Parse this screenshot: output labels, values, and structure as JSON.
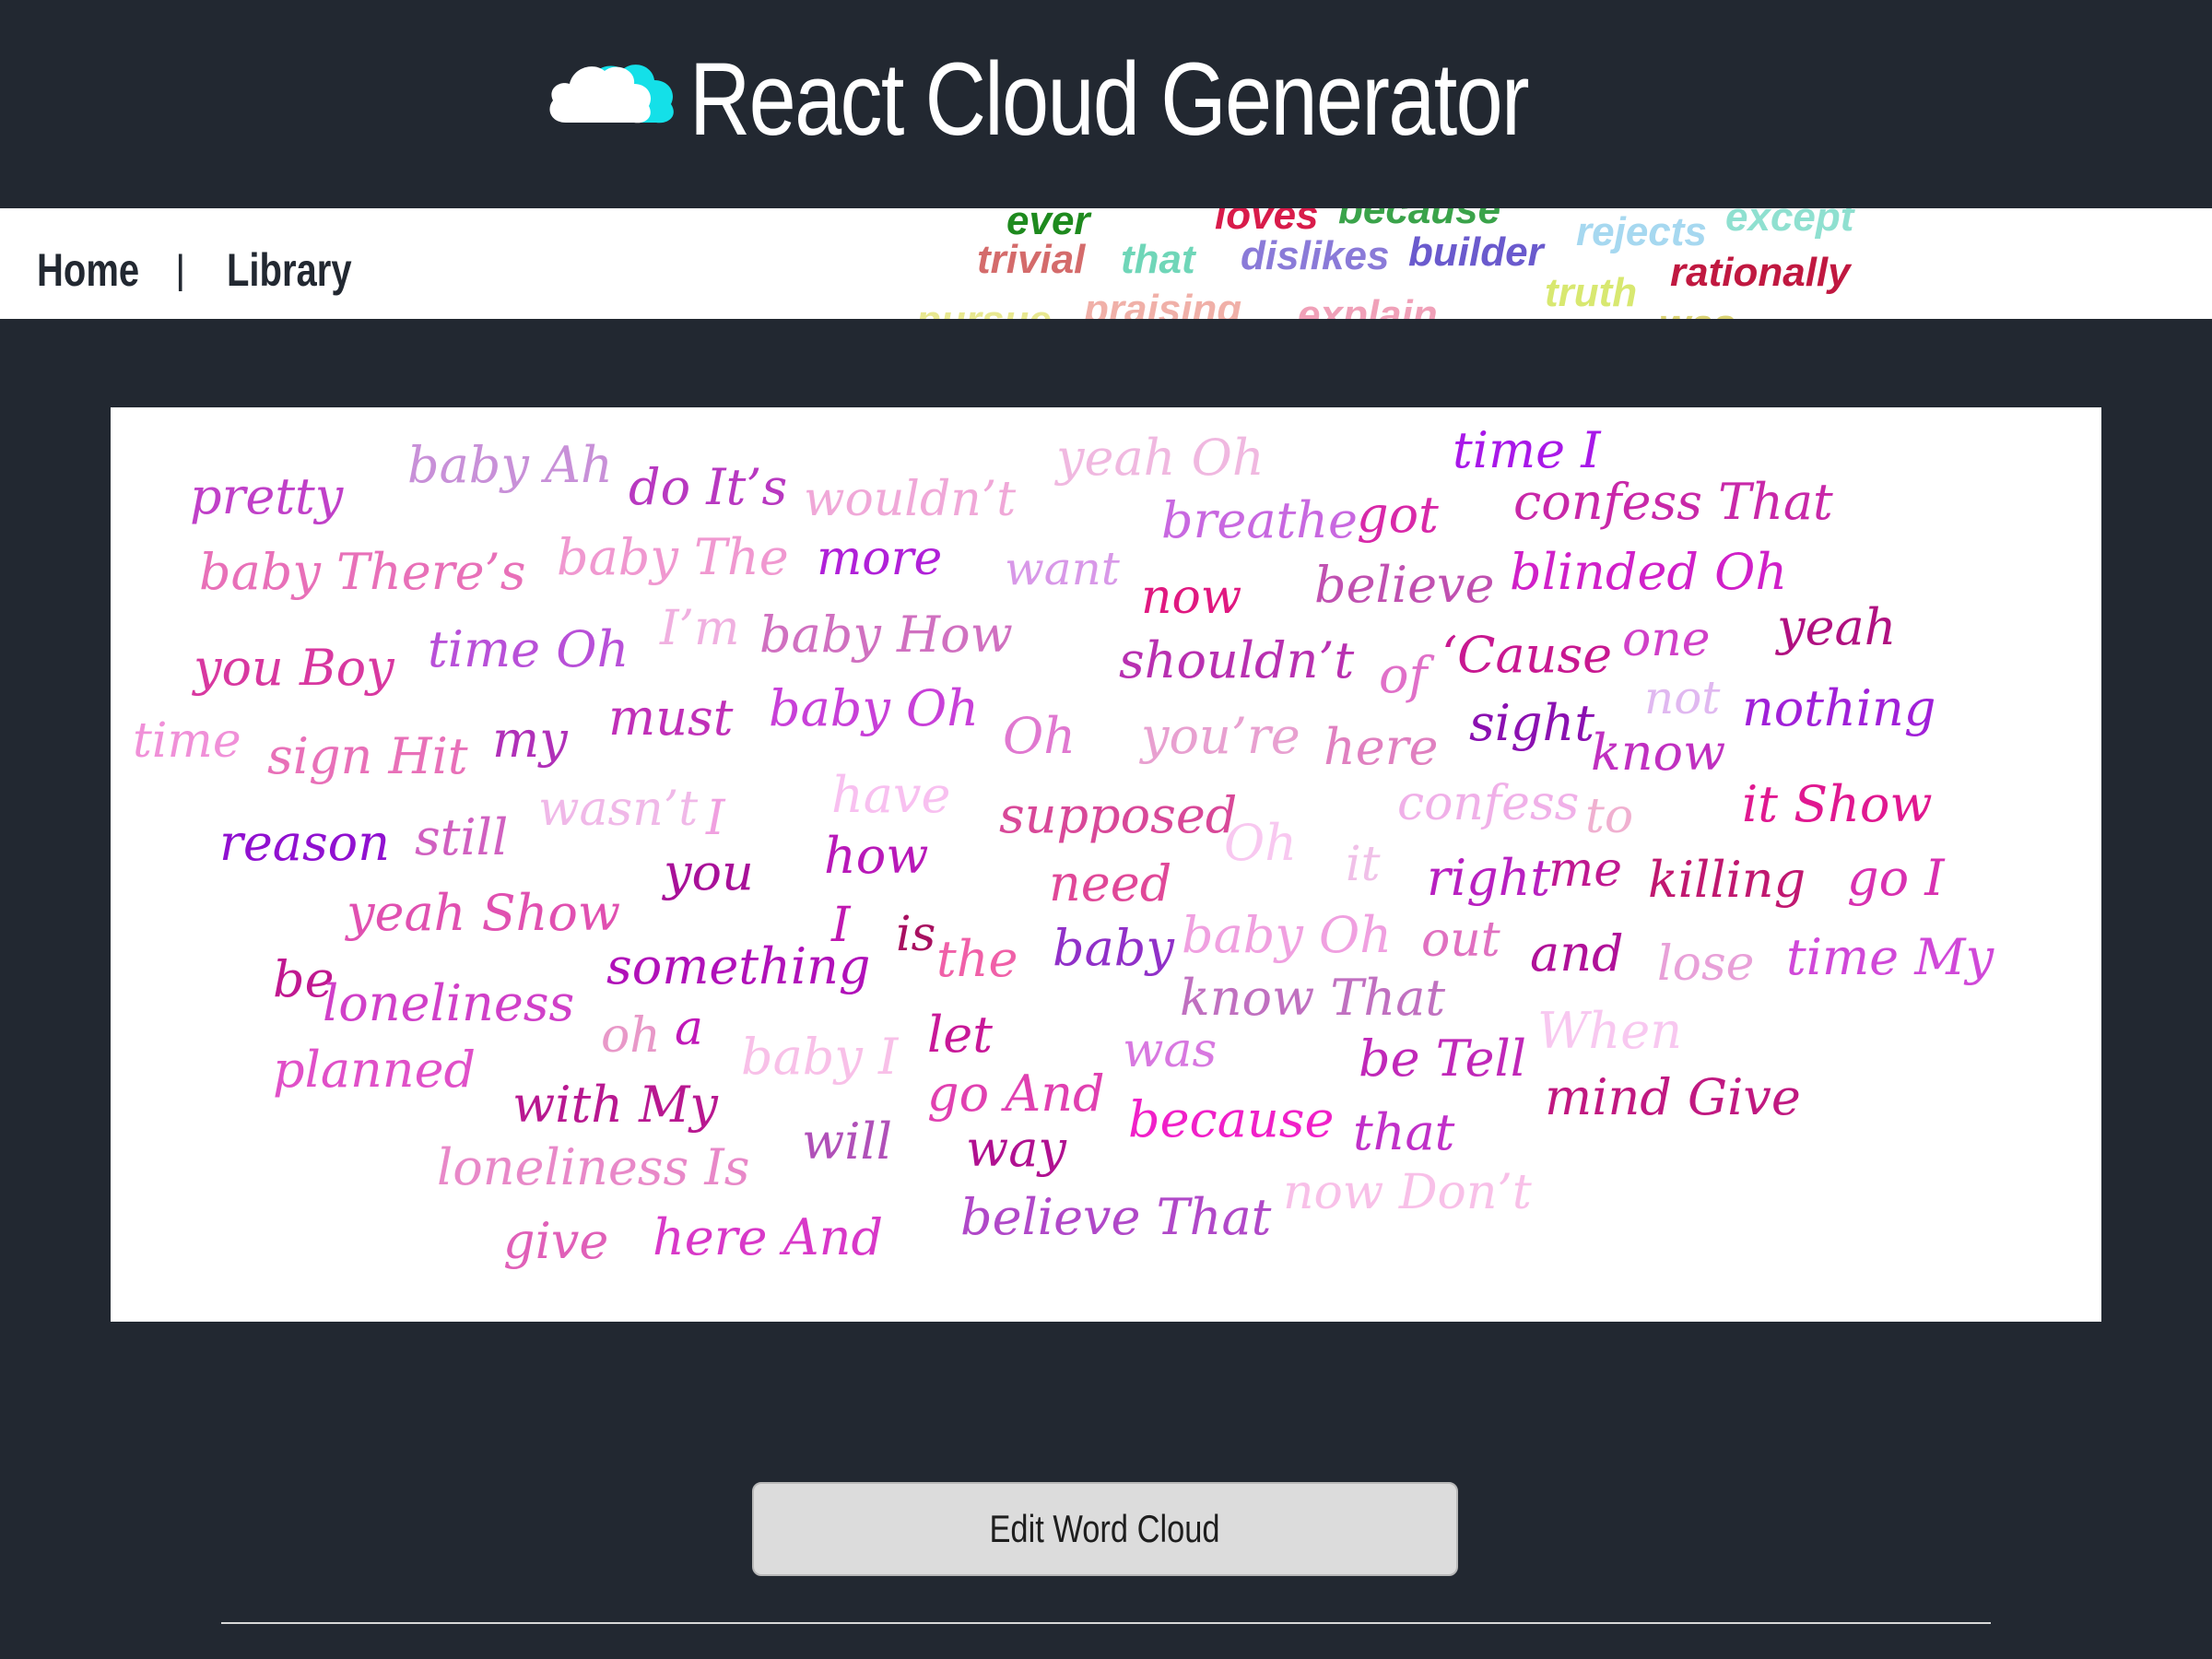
{
  "app": {
    "title": "React Cloud Generator",
    "logo_icon": "cloud-icon"
  },
  "nav": {
    "home_label": "Home",
    "separator": "|",
    "library_label": "Library"
  },
  "banner_words": [
    {
      "text": "ever",
      "color": "#1e8a1e"
    },
    {
      "text": "loves",
      "color": "#d81b4a"
    },
    {
      "text": "because",
      "color": "#3aa34a"
    },
    {
      "text": "except",
      "color": "#8fe0d0"
    },
    {
      "text": "trivial",
      "color": "#d46b6b"
    },
    {
      "text": "that",
      "color": "#6fd6b8"
    },
    {
      "text": "dislikes",
      "color": "#8a7ad8"
    },
    {
      "text": "builder",
      "color": "#6a5acd"
    },
    {
      "text": "rejects",
      "color": "#a6d8f0"
    },
    {
      "text": "rationally",
      "color": "#c01840"
    },
    {
      "text": "pursue",
      "color": "#e8e890"
    },
    {
      "text": "praising",
      "color": "#f0b0a8"
    },
    {
      "text": "explain",
      "color": "#f0a0b8"
    },
    {
      "text": "truth",
      "color": "#d8e870"
    },
    {
      "text": "was",
      "color": "#d8d070"
    }
  ],
  "cloud_words": [
    {
      "text": "pretty",
      "color": "#c040c8"
    },
    {
      "text": "baby Ah",
      "color": "#c890d8"
    },
    {
      "text": "do It’s",
      "color": "#b838c0"
    },
    {
      "text": "wouldn’t",
      "color": "#f0a8d8"
    },
    {
      "text": "yeah Oh",
      "color": "#f0b8e0"
    },
    {
      "text": "time I",
      "color": "#a818e8"
    },
    {
      "text": "breathe",
      "color": "#c868e0"
    },
    {
      "text": "got",
      "color": "#d828a8"
    },
    {
      "text": "confess That",
      "color": "#c828a8"
    },
    {
      "text": "baby There’s",
      "color": "#e870b8"
    },
    {
      "text": "baby The",
      "color": "#f098d0"
    },
    {
      "text": "more",
      "color": "#b020d8"
    },
    {
      "text": "want",
      "color": "#d898e8"
    },
    {
      "text": "now",
      "color": "#e01880"
    },
    {
      "text": "believe",
      "color": "#c050b0"
    },
    {
      "text": "blinded Oh",
      "color": "#d020c8"
    },
    {
      "text": "you Boy",
      "color": "#d838a0"
    },
    {
      "text": "time Oh",
      "color": "#b850d8"
    },
    {
      "text": "I’m",
      "color": "#f0b0e0"
    },
    {
      "text": "baby How",
      "color": "#d070c0"
    },
    {
      "text": "shouldn’t",
      "color": "#b830b0"
    },
    {
      "text": "of",
      "color": "#e070c8"
    },
    {
      "text": "‘Cause",
      "color": "#c81890"
    },
    {
      "text": "one",
      "color": "#d040c8"
    },
    {
      "text": "yeah",
      "color": "#b01080"
    },
    {
      "text": "time",
      "color": "#f090d8"
    },
    {
      "text": "sign Hit",
      "color": "#e870b8"
    },
    {
      "text": "my",
      "color": "#b030b8"
    },
    {
      "text": "must",
      "color": "#c030b8"
    },
    {
      "text": "baby Oh",
      "color": "#c840d8"
    },
    {
      "text": "Oh",
      "color": "#e078d0"
    },
    {
      "text": "you’re",
      "color": "#e8a0d0"
    },
    {
      "text": "here",
      "color": "#e080c0"
    },
    {
      "text": "sight",
      "color": "#8a10b0"
    },
    {
      "text": "not",
      "color": "#e0b8f0"
    },
    {
      "text": "know",
      "color": "#c030c0"
    },
    {
      "text": "nothing",
      "color": "#a020d8"
    },
    {
      "text": "reason",
      "color": "#9010d0"
    },
    {
      "text": "still",
      "color": "#d060c0"
    },
    {
      "text": "wasn’t",
      "color": "#f0b8e8"
    },
    {
      "text": "I",
      "color": "#f0a0e0"
    },
    {
      "text": "have",
      "color": "#f8c0f0"
    },
    {
      "text": "supposed",
      "color": "#d84898"
    },
    {
      "text": "Oh",
      "color": "#f8c8f0"
    },
    {
      "text": "confess",
      "color": "#f0b0e8"
    },
    {
      "text": "to",
      "color": "#f0b0d0"
    },
    {
      "text": "it Show",
      "color": "#e01890"
    },
    {
      "text": "yeah Show",
      "color": "#e050b0"
    },
    {
      "text": "you",
      "color": "#a81098"
    },
    {
      "text": "how",
      "color": "#b818b8"
    },
    {
      "text": "need",
      "color": "#e04898"
    },
    {
      "text": "it",
      "color": "#f0c0e8"
    },
    {
      "text": "right",
      "color": "#b820c0"
    },
    {
      "text": "me",
      "color": "#c01890"
    },
    {
      "text": "killing",
      "color": "#c01870"
    },
    {
      "text": "go I",
      "color": "#d830b0"
    },
    {
      "text": "I",
      "color": "#c018b0"
    },
    {
      "text": "is",
      "color": "#a81060"
    },
    {
      "text": "be",
      "color": "#c01890"
    },
    {
      "text": "something",
      "color": "#b010b8"
    },
    {
      "text": "the",
      "color": "#f060a8"
    },
    {
      "text": "baby",
      "color": "#9030c8"
    },
    {
      "text": "baby Oh",
      "color": "#f0a0e0"
    },
    {
      "text": "out",
      "color": "#e070c0"
    },
    {
      "text": "and",
      "color": "#b01098"
    },
    {
      "text": "lose",
      "color": "#e8a0d8"
    },
    {
      "text": "time My",
      "color": "#d048d8"
    },
    {
      "text": "loneliness",
      "color": "#d040c8"
    },
    {
      "text": "know That",
      "color": "#c070c0"
    },
    {
      "text": "oh",
      "color": "#e898c8"
    },
    {
      "text": "a",
      "color": "#c018b8"
    },
    {
      "text": "planned",
      "color": "#e050c8"
    },
    {
      "text": "baby I",
      "color": "#f8c0e8"
    },
    {
      "text": "let",
      "color": "#c81898"
    },
    {
      "text": "was",
      "color": "#d878e0"
    },
    {
      "text": "be Tell",
      "color": "#c028b8"
    },
    {
      "text": "When",
      "color": "#f8c8f0"
    },
    {
      "text": "with My",
      "color": "#b81890"
    },
    {
      "text": "go And",
      "color": "#e040b0"
    },
    {
      "text": "mind Give",
      "color": "#c01880"
    },
    {
      "text": "because",
      "color": "#f020c8"
    },
    {
      "text": "that",
      "color": "#c030c8"
    },
    {
      "text": "will",
      "color": "#b050b8"
    },
    {
      "text": "way",
      "color": "#b01090"
    },
    {
      "text": "loneliness Is",
      "color": "#e888c8"
    },
    {
      "text": "now Don’t",
      "color": "#f8c0e8"
    },
    {
      "text": "believe That",
      "color": "#b048c8"
    },
    {
      "text": "give",
      "color": "#e060b8"
    },
    {
      "text": "here And",
      "color": "#d838c8"
    }
  ],
  "actions": {
    "edit_label": "Edit Word Cloud"
  }
}
